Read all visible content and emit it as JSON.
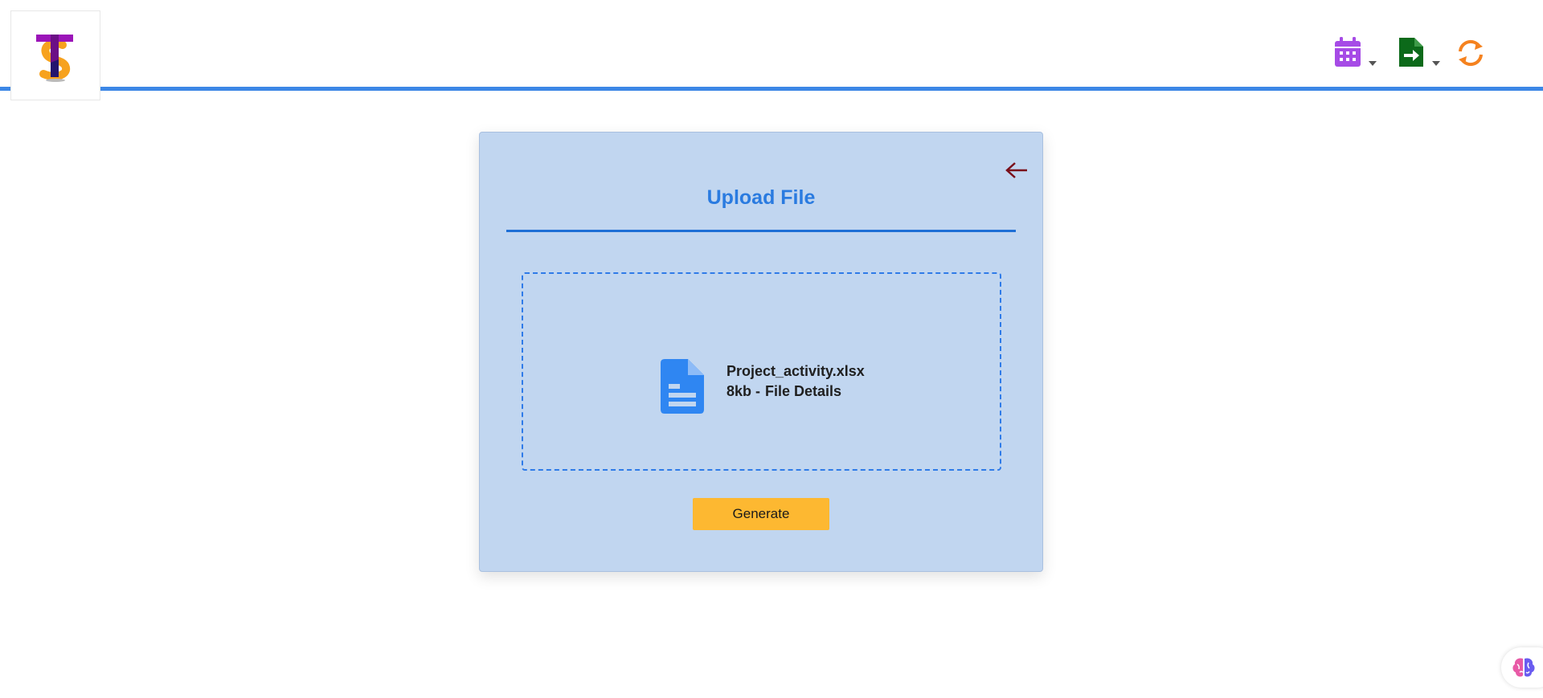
{
  "header": {
    "logo": {
      "icon": "ts-brand-logo-icon"
    },
    "toolbar": [
      {
        "icon": "calendar-icon",
        "color": "#a64be6",
        "has_dropdown": true
      },
      {
        "icon": "file-export-icon",
        "color": "#0c6a1a",
        "has_dropdown": true
      },
      {
        "icon": "refresh-icon",
        "color": "#f5821f",
        "has_dropdown": false
      }
    ],
    "accent_color": "#3c87e6"
  },
  "upload_card": {
    "title": "Upload File",
    "back_icon": "arrow-left-icon",
    "dropzone": {
      "file_icon": "document-icon",
      "file_name": "Project_activity.xlsx",
      "file_size": "8kb -",
      "details_link": "File Details"
    },
    "generate_label": "Generate",
    "background_color": "#c1d6f0",
    "button_color": "#fdb831"
  },
  "assistant_widget": {
    "icon": "brain-icon"
  }
}
